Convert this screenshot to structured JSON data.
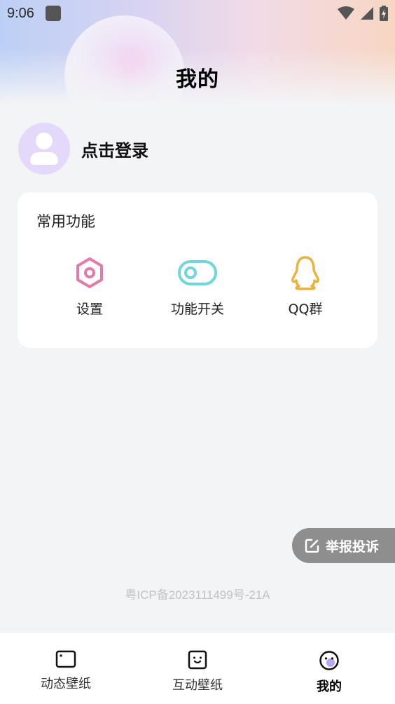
{
  "status_bar": {
    "time": "9:06"
  },
  "header": {
    "title": "我的"
  },
  "profile": {
    "login_label": "点击登录"
  },
  "common_functions": {
    "title": "常用功能",
    "items": [
      {
        "label": "设置",
        "icon": "settings-hexagon-icon",
        "color": "#e37aa8"
      },
      {
        "label": "功能开关",
        "icon": "toggle-switch-icon",
        "color": "#6fd6dc"
      },
      {
        "label": "QQ群",
        "icon": "qq-penguin-icon",
        "color": "#e8b43f"
      }
    ]
  },
  "report_button": {
    "label": "举报投诉",
    "icon": "edit-icon"
  },
  "footer": {
    "icp": "粤ICP备2023111499号-21A"
  },
  "bottom_nav": {
    "items": [
      {
        "label": "动态壁纸",
        "icon": "wallpaper-tv-icon"
      },
      {
        "label": "互动壁纸",
        "icon": "smile-box-icon"
      },
      {
        "label": "我的",
        "icon": "profile-face-icon",
        "active": true
      }
    ]
  },
  "colors": {
    "avatar_bg": "#e4d9fb",
    "page_bg": "#f3f4f6",
    "report_bg": "#8e8e8e"
  }
}
